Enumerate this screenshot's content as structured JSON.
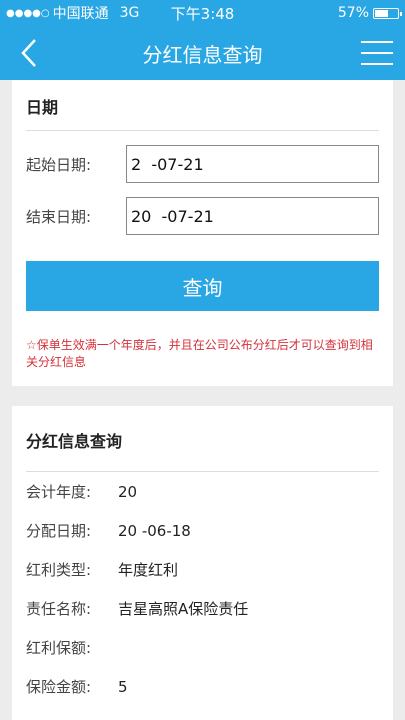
{
  "status_bar": {
    "carrier": "中国联通",
    "network": "3G",
    "time": "下午3:48",
    "battery": "57%",
    "battery_level": 0.57
  },
  "nav": {
    "title": "分红信息查询",
    "back_icon": "chevron-left-icon",
    "menu_icon": "hamburger-menu-icon"
  },
  "date_section": {
    "title": "日期",
    "start_label": "起始日期:",
    "start_value": "2  -07-21",
    "end_label": "结束日期:",
    "end_value": "20  -07-21",
    "query_button": "查询",
    "notice": "☆保单生效满一个年度后，并且在公司公布分红后才可以查询到相关分红信息"
  },
  "result_section": {
    "title": "分红信息查询",
    "rows": [
      {
        "label": "会计年度:",
        "value": "20"
      },
      {
        "label": "分配日期:",
        "value": "20  -06-18"
      },
      {
        "label": "红利类型:",
        "value": "年度红利"
      },
      {
        "label": "责任名称:",
        "value": "吉星高照A保险责任"
      },
      {
        "label": "红利保额:",
        "value": "  "
      },
      {
        "label": "保险金额:",
        "value": "5  "
      }
    ]
  },
  "colors": {
    "accent": "#29a6e4",
    "notice": "#d4313a",
    "background": "#ececec"
  }
}
